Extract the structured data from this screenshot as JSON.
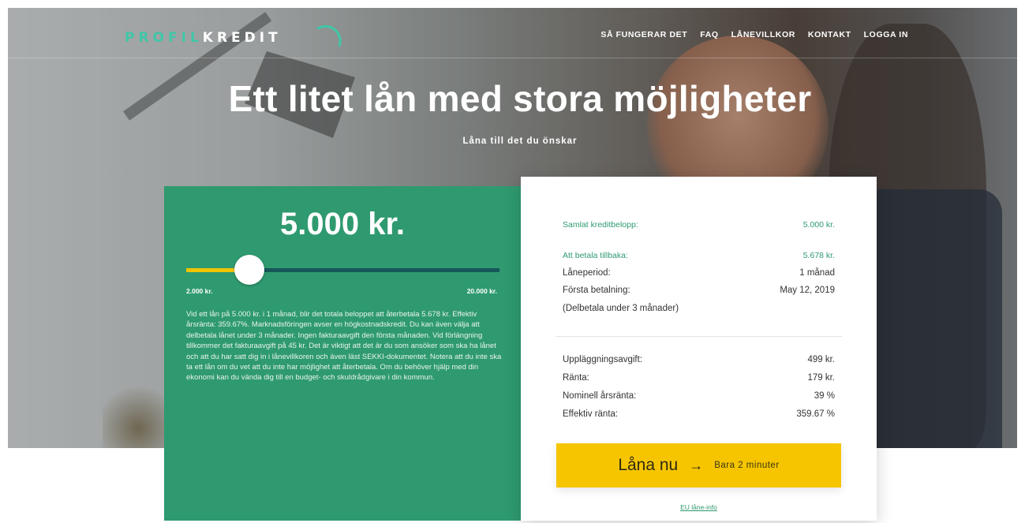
{
  "nav": {
    "logo_part1": "PROFIL",
    "logo_part2": "KREDIT",
    "links": [
      "SÅ FUNGERAR DET",
      "FAQ",
      "LÅNEVILLKOR",
      "KONTAKT",
      "LOGGA IN"
    ]
  },
  "hero": {
    "title": "Ett litet lån med stora möjligheter",
    "subtitle": "Låna till det du önskar"
  },
  "calculator": {
    "amount": "5.000 kr.",
    "slider_fraction": 0.167,
    "min_label": "2.000 kr.",
    "max_label": "20.000 kr.",
    "disclaimer": "Vid ett lån på 5.000 kr. i 1 månad, blir det totala beloppet att återbetala 5.678 kr. Effektiv årsränta: 359.67%. Marknadsföringen avser en högkostnadskredit. Du kan även välja att delbetala lånet under 3 månader. Ingen fakturaavgift den första månaden. Vid förlängning tillkommer det fakturaavgift på 45 kr. Det är viktigt att det är du som ansöker som ska ha lånet och att du har satt dig in i lånevillkoren och även läst SEKKI-dokumentet. Notera att du inte ska ta ett lån om du vet att du inte har möjlighet att återbetala. Om du behöver hjälp med din ekonomi kan du vända dig till en budget- och skuldrådgivare i din kommun."
  },
  "summary": {
    "total_credit_label": "Samlat kreditbelopp:",
    "total_credit_value": "5.000 kr.",
    "repay_label": "Att betala tillbaka:",
    "repay_value": "5.678 kr.",
    "period_label": "Låneperiod:",
    "period_value": "1 månad",
    "first_payment_label": "Första betalning:",
    "first_payment_value": "May 12, 2019",
    "installment_note": "(Delbetala under 3 månader)",
    "setup_fee_label": "Uppläggningsavgift:",
    "setup_fee_value": "499 kr.",
    "interest_label": "Ränta:",
    "interest_value": "179 kr.",
    "nominal_rate_label": "Nominell årsränta:",
    "nominal_rate_value": "39 %",
    "effective_rate_label": "Effektiv ränta:",
    "effective_rate_value": "359.67 %"
  },
  "cta": {
    "label": "Låna nu",
    "arrow": "→",
    "sublabel": "Bara 2 minuter"
  },
  "eu_link": "EU låne-info",
  "colors": {
    "brand_green": "#2f9a6f",
    "accent_yellow": "#f6c500",
    "slider_track": "#16585a"
  }
}
